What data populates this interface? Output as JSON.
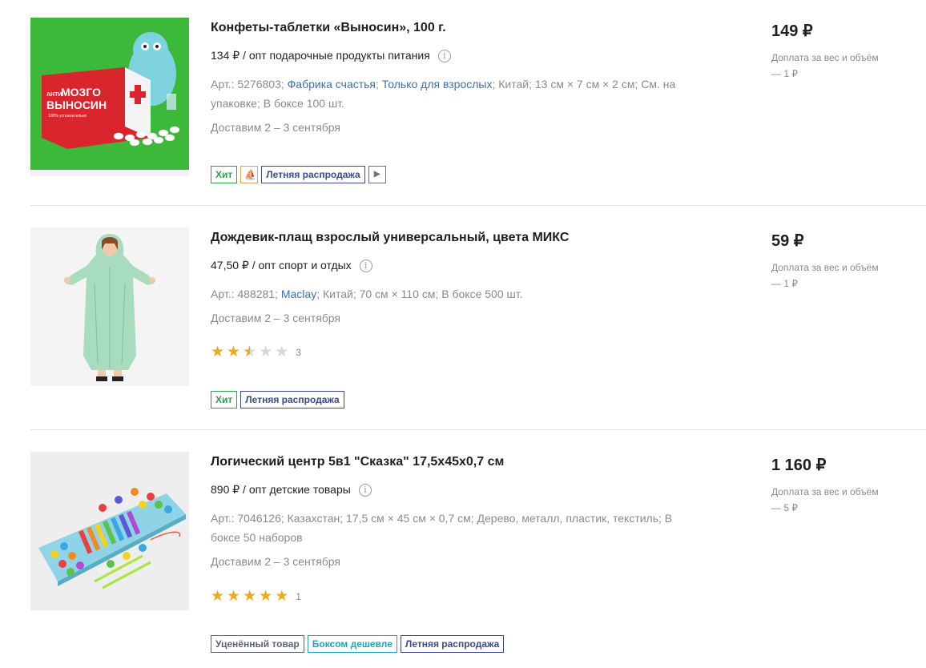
{
  "products": [
    {
      "title": "Конфеты-таблетки «Выносин», 100 г.",
      "wholesale": "134 ₽ / опт подарочные продукты питания",
      "attributes": [
        {
          "text": "Арт.: 5276803; ",
          "link": false
        },
        {
          "text": "Фабрика счастья",
          "link": true
        },
        {
          "text": "; ",
          "link": false
        },
        {
          "text": "Только для взрослых",
          "link": true
        },
        {
          "text": "; Китай; 13 см × 7 см × 2 см; См. на упаковке; В боксе 100 шт.",
          "link": false
        }
      ],
      "delivery": "Доставим 2 – 3 сентября",
      "badges": [
        "Хит",
        "ship-icon",
        "Летняя распродажа",
        "play-icon"
      ],
      "price": "149 ₽",
      "surcharge": "Доплата за вес и объём — 1 ₽",
      "image_text": {
        "top": "АНТИ",
        "main1": "МОЗГО",
        "main2": "ВЫНОСИН",
        "sub": "100% успокоительно"
      }
    },
    {
      "title": "Дождевик-плащ взрослый универсальный, цвета МИКС",
      "wholesale": "47,50 ₽ / опт спорт и отдых",
      "attributes": [
        {
          "text": "Арт.: 488281; ",
          "link": false
        },
        {
          "text": "Maclay",
          "link": true
        },
        {
          "text": "; Китай; 70 см × 110 см; В боксе 500 шт.",
          "link": false
        }
      ],
      "delivery": "Доставим 2 – 3 сентября",
      "rating": {
        "value": 2.5,
        "max": 5,
        "count": "3"
      },
      "badges": [
        "Хит",
        "Летняя распродажа"
      ],
      "price": "59 ₽",
      "surcharge": "Доплата за вес и объём — 1 ₽"
    },
    {
      "title": "Логический центр 5в1 \"Сказка\" 17,5х45х0,7 см",
      "wholesale": "890 ₽ / опт детские товары",
      "attributes": [
        {
          "text": "Арт.: 7046126; Казахстан; 17,5 см × 45 см × 0,7 см; Дерево, металл, пластик, текстиль; В боксе 50 наборов",
          "link": false
        }
      ],
      "delivery": "Доставим 2 – 3 сентября",
      "rating": {
        "value": 5,
        "max": 5,
        "count": "1"
      },
      "badges": [
        "Уценённый товар",
        "Боксом дешевле",
        "Летняя распродажа"
      ],
      "price": "1 160 ₽",
      "surcharge": "Доплата за вес и объём — 5 ₽"
    }
  ],
  "colors": {
    "link": "#3a6fb0",
    "badge_hit": "#2e9e4a",
    "badge_sale": "#3b4a8a",
    "badge_markdown": "#5b6470",
    "badge_box": "#1ea6bf",
    "star": "#f0a91c"
  }
}
